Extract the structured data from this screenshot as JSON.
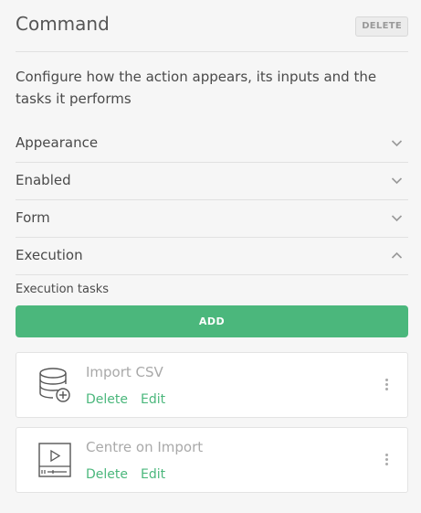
{
  "header": {
    "title": "Command",
    "delete_label": "DELETE"
  },
  "description": "Configure how the action appears, its inputs and the tasks it performs",
  "sections": [
    {
      "label": "Appearance",
      "expanded": false
    },
    {
      "label": "Enabled",
      "expanded": false
    },
    {
      "label": "Form",
      "expanded": false
    },
    {
      "label": "Execution",
      "expanded": true
    }
  ],
  "execution": {
    "tasks_label": "Execution tasks",
    "add_label": "ADD",
    "tasks": [
      {
        "name": "Import CSV",
        "icon": "database-add-icon",
        "delete_label": "Delete",
        "edit_label": "Edit"
      },
      {
        "name": "Centre on Import",
        "icon": "media-player-icon",
        "delete_label": "Delete",
        "edit_label": "Edit"
      }
    ]
  },
  "colors": {
    "accent": "#4bb77c",
    "background": "#f6f6f6",
    "divider": "#e1e1e1"
  }
}
